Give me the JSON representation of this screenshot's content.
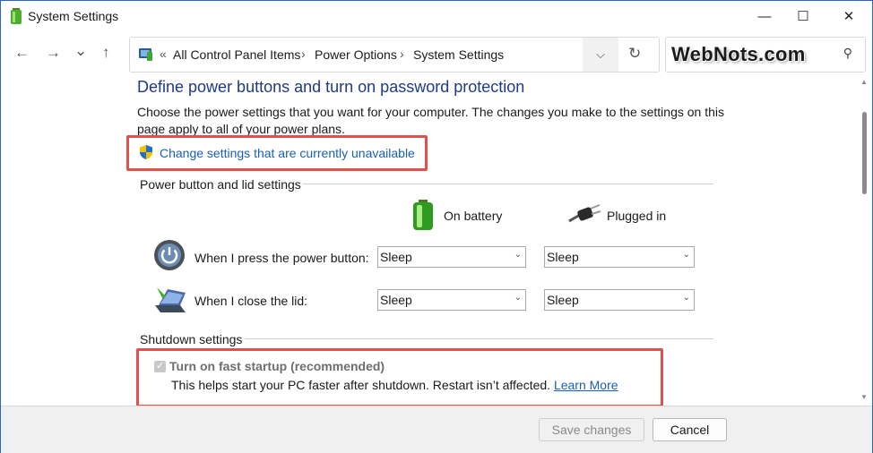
{
  "window": {
    "title": "System Settings",
    "minimize": "—",
    "maximize": "☐",
    "close": "✕"
  },
  "nav": {
    "back": "←",
    "forward": "→",
    "recent": "⌄",
    "up": "↑"
  },
  "address": {
    "overflow": "«",
    "crumbs": [
      "All Control Panel Items",
      "Power Options",
      "System Settings"
    ],
    "separator": "›",
    "dropdown": "⌵",
    "refresh": "↻"
  },
  "search": {
    "watermark": "WebNots.com",
    "icon": "⚲"
  },
  "main": {
    "heading": "Define power buttons and turn on password protection",
    "description": "Choose the power settings that you want for your computer. The changes you make to the settings on this page apply to all of your power plans.",
    "change_link": "Change settings that are currently unavailable",
    "power_section": "Power button and lid settings",
    "col_battery": "On battery",
    "col_plugged": "Plugged in",
    "rows": [
      {
        "label": "When I press the power button:",
        "battery": "Sleep",
        "plugged": "Sleep"
      },
      {
        "label": "When I close the lid:",
        "battery": "Sleep",
        "plugged": "Sleep"
      }
    ],
    "shutdown_section": "Shutdown settings",
    "fast_startup": {
      "label": "Turn on fast startup (recommended)",
      "checked": true,
      "desc": "This helps start your PC faster after shutdown. Restart isn’t affected.",
      "learn_more": "Learn More"
    }
  },
  "footer": {
    "save": "Save changes",
    "cancel": "Cancel"
  },
  "colors": {
    "accent_link": "#1a5fb4",
    "heading": "#1e3a8a",
    "highlight": "#e0514c"
  }
}
